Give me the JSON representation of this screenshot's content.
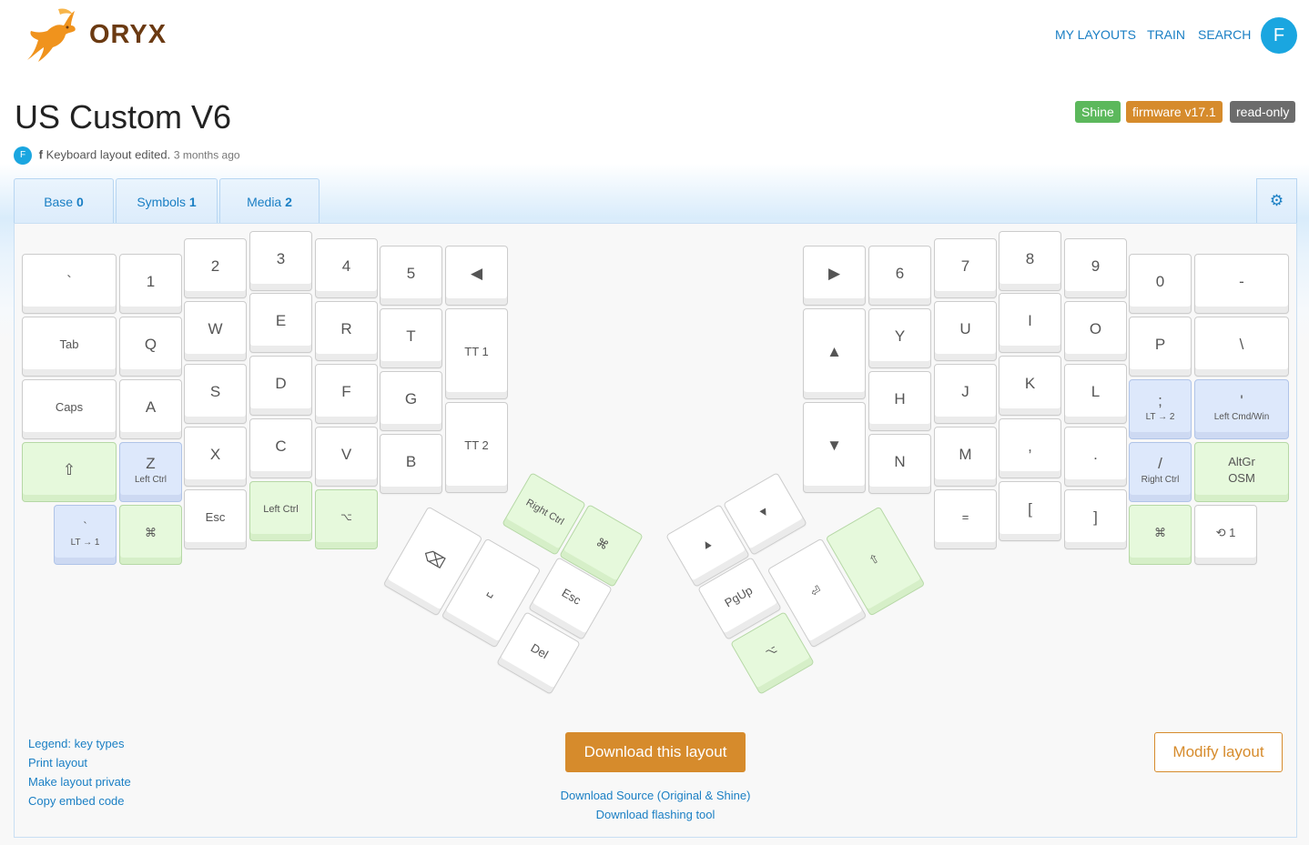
{
  "brand": "ORYX",
  "nav": {
    "my_layouts": "MY LAYOUTS",
    "train": "TRAIN",
    "search": "SEARCH",
    "avatar": "F"
  },
  "layout": {
    "title": "US Custom V6",
    "badges": [
      {
        "label": "Shine",
        "color": "#5cb85c"
      },
      {
        "label": "firmware v17.1",
        "color": "#d68b2c"
      },
      {
        "label": "read-only",
        "color": "#6c6c6c"
      }
    ],
    "author_avatar": "F",
    "author": "f",
    "edit_text": "Keyboard layout edited.",
    "edited_ago": "3 months ago"
  },
  "tabs": [
    {
      "name": "Base",
      "index": "0"
    },
    {
      "name": "Symbols",
      "index": "1"
    },
    {
      "name": "Media",
      "index": "2"
    }
  ],
  "keys": {
    "l_grave": "`",
    "l_1": "1",
    "l_2": "2",
    "l_3": "3",
    "l_4": "4",
    "l_5": "5",
    "l_left": "◀",
    "l_tab": "Tab",
    "l_q": "Q",
    "l_w": "W",
    "l_e": "E",
    "l_r": "R",
    "l_t": "T",
    "l_tt1": "TT 1",
    "l_caps": "Caps",
    "l_a": "A",
    "l_s": "S",
    "l_d": "D",
    "l_f": "F",
    "l_g": "G",
    "l_tt2": "TT 2",
    "l_shift": "⇧",
    "l_z": "Z",
    "l_z_sub": "Left Ctrl",
    "l_x": "X",
    "l_c": "C",
    "l_v": "V",
    "l_b": "B",
    "l_lt_main": "`",
    "l_lt_sub": "LT → 1",
    "l_cmd": "⌘",
    "l_esc": "Esc",
    "l_lctrl": "Left Ctrl",
    "l_alt": "⌥",
    "r_right": "▶",
    "r_6": "6",
    "r_7": "7",
    "r_8": "8",
    "r_9": "9",
    "r_0": "0",
    "r_minus": "-",
    "r_up": "▲",
    "r_y": "Y",
    "r_u": "U",
    "r_i": "I",
    "r_o": "O",
    "r_p": "P",
    "r_bslash": "\\",
    "r_down": "▼",
    "r_h": "H",
    "r_j": "J",
    "r_k": "K",
    "r_l": "L",
    "r_semi": ";",
    "r_semi_sub": "LT → 2",
    "r_quote": "'",
    "r_quote_sub": "Left Cmd/Win",
    "r_n": "N",
    "r_m": "M",
    "r_comma": ",",
    "r_dot": ".",
    "r_slash": "/",
    "r_slash_sub": "Right Ctrl",
    "r_altgr": "AltGr",
    "r_osm": "OSM",
    "r_eq": "=",
    "r_lbr": "[",
    "r_rbr": "]",
    "r_cmd": "⌘",
    "r_undo": "⟲ 1",
    "lt_rctrl": "Right Ctrl",
    "lt_cmd": "⌘",
    "lt_mouse": "⌫",
    "lt_space": "␣",
    "lt_esc": "Esc",
    "lt_del": "Del",
    "rt_up": "▲",
    "rt_down": "▼",
    "rt_pgup": "PgUp",
    "rt_alt": "⌥",
    "rt_enter": "⏎",
    "rt_shift": "⇧"
  },
  "footer": {
    "links": [
      "Legend: key types",
      "Print layout",
      "Make layout private",
      "Copy embed code"
    ],
    "download_button": "Download this layout",
    "download_source": "Download Source (Original & Shine)",
    "download_tool": "Download flashing tool",
    "modify_button": "Modify layout"
  }
}
